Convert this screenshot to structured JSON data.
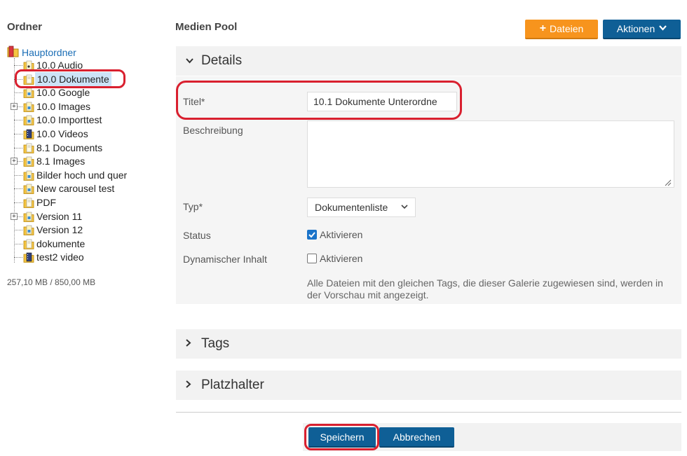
{
  "sidebar": {
    "title": "Ordner",
    "root_label": "Hauptordner",
    "items": [
      {
        "label": "10.0 Audio",
        "expandable": false,
        "type": "audio"
      },
      {
        "label": "10.0 Dokumente",
        "expandable": false,
        "type": "doc",
        "selected": true
      },
      {
        "label": "10.0 Google",
        "expandable": false,
        "type": "image"
      },
      {
        "label": "10.0 Images",
        "expandable": true,
        "type": "image"
      },
      {
        "label": "10.0 Importtest",
        "expandable": false,
        "type": "image"
      },
      {
        "label": "10.0 Videos",
        "expandable": false,
        "type": "video"
      },
      {
        "label": "8.1 Documents",
        "expandable": false,
        "type": "doc"
      },
      {
        "label": "8.1 Images",
        "expandable": true,
        "type": "image"
      },
      {
        "label": "Bilder hoch und quer",
        "expandable": false,
        "type": "image"
      },
      {
        "label": "New carousel test",
        "expandable": false,
        "type": "image"
      },
      {
        "label": "PDF",
        "expandable": false,
        "type": "doc"
      },
      {
        "label": "Version 11",
        "expandable": true,
        "type": "image"
      },
      {
        "label": "Version 12",
        "expandable": false,
        "type": "image"
      },
      {
        "label": "dokumente",
        "expandable": false,
        "type": "doc"
      },
      {
        "label": "test2 video",
        "expandable": false,
        "type": "video"
      }
    ],
    "storage": "257,10 MB / 850,00 MB"
  },
  "main": {
    "title": "Medien Pool",
    "add_files_label": "Dateien",
    "actions_label": "Aktionen",
    "details": {
      "header": "Details",
      "title_label": "Titel*",
      "title_value": "10.1 Dokumente Unterordne",
      "description_label": "Beschreibung",
      "description_value": "",
      "type_label": "Typ*",
      "type_value": "Dokumentenliste",
      "status_label": "Status",
      "status_checkbox_label": "Aktivieren",
      "status_checked": true,
      "dynamic_label": "Dynamischer Inhalt",
      "dynamic_checkbox_label": "Aktivieren",
      "dynamic_checked": false,
      "help_text": "Alle Dateien mit den gleichen Tags, die dieser Galerie zugewiesen sind, werden in der Vorschau mit angezeigt."
    },
    "tags_header": "Tags",
    "placeholder_header": "Platzhalter",
    "save_label": "Speichern",
    "cancel_label": "Abbrechen"
  },
  "colors": {
    "primary": "#0f5f96",
    "accent": "#f7941d",
    "annotation": "#d9202f",
    "link": "#1a6db5"
  }
}
